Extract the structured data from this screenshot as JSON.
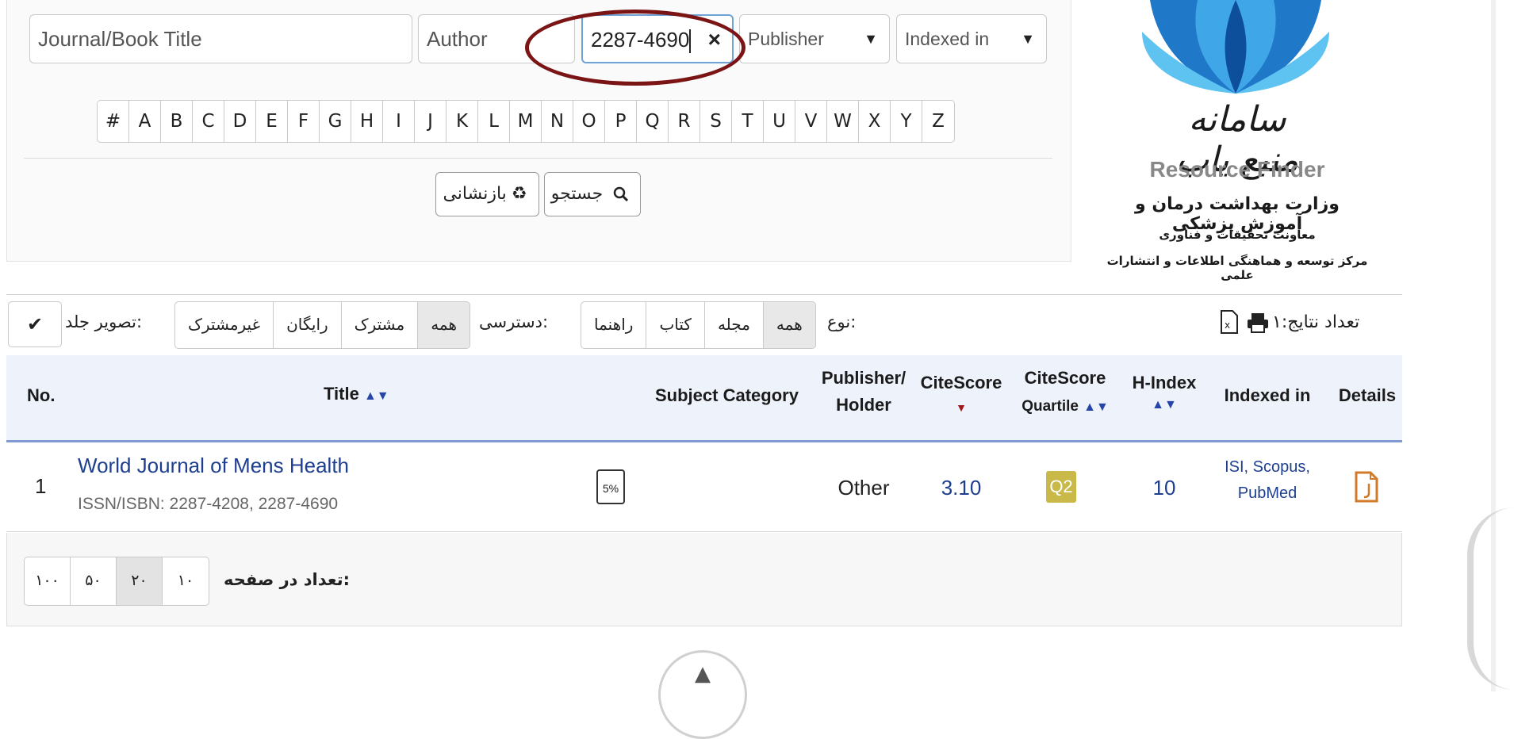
{
  "search": {
    "title_placeholder": "Journal/Book Title",
    "author_placeholder": "Author",
    "issn_value": "2287-4690",
    "clear_symbol": "×",
    "publisher_select": "Publisher",
    "indexed_select": "Indexed in"
  },
  "alphabet": [
    "#",
    "A",
    "B",
    "C",
    "D",
    "E",
    "F",
    "G",
    "H",
    "I",
    "J",
    "K",
    "L",
    "M",
    "N",
    "O",
    "P",
    "Q",
    "R",
    "S",
    "T",
    "U",
    "V",
    "W",
    "X",
    "Y",
    "Z"
  ],
  "actions": {
    "search_label": "جستجو",
    "reset_label": "بازنشانی"
  },
  "logo": {
    "script": "سامانه منبع یاب",
    "english": "Resource Finder",
    "line1": "وزارت بهداشت درمان و آموزش پزشکی",
    "line2": "معاونت تحقیقات و فناوری",
    "line3": "مرکز توسعه و هماهنگی اطلاعات و انتشارات علمی"
  },
  "results": {
    "count_label": "تعداد نتایج:۱"
  },
  "filters": {
    "type_label": "نوع:",
    "type_options": [
      "همه",
      "مجله",
      "کتاب",
      "راهنما"
    ],
    "access_label": "دسترسی:",
    "access_options": [
      "همه",
      "مشترک",
      "رایگان",
      "غیرمشترک"
    ],
    "cover_label": "تصویر جلد:",
    "cover_check": "✔"
  },
  "table": {
    "headers": {
      "no": "No.",
      "title": "Title",
      "subject": "Subject Category",
      "publisher_1": "Publisher/",
      "publisher_2": "Holder",
      "citescore": "CiteScore",
      "quartile_1": "CiteScore",
      "quartile_2": "Quartile",
      "hindex": "H-Index",
      "indexed": "Indexed in",
      "details": "Details"
    },
    "rows": [
      {
        "no": "1",
        "title": "World Journal of Mens Health",
        "issn": "ISSN/ISBN: 2287-4208, 2287-4690",
        "subject_badge": "5%",
        "publisher": "Other",
        "citescore": "3.10",
        "quartile": "Q2",
        "hindex": "10",
        "indexed_1": "ISI, Scopus,",
        "indexed_2": "PubMed"
      }
    ]
  },
  "pager": {
    "label": "تعداد در صفحه:",
    "options": [
      "۱۰۰",
      "۵۰",
      "۲۰",
      "۱۰"
    ]
  },
  "colors": {
    "accent_blue": "#2546a6",
    "quartile_q2": "#c9b949",
    "highlight_ellipse": "#7b1414",
    "details_icon": "#d07a2a"
  }
}
